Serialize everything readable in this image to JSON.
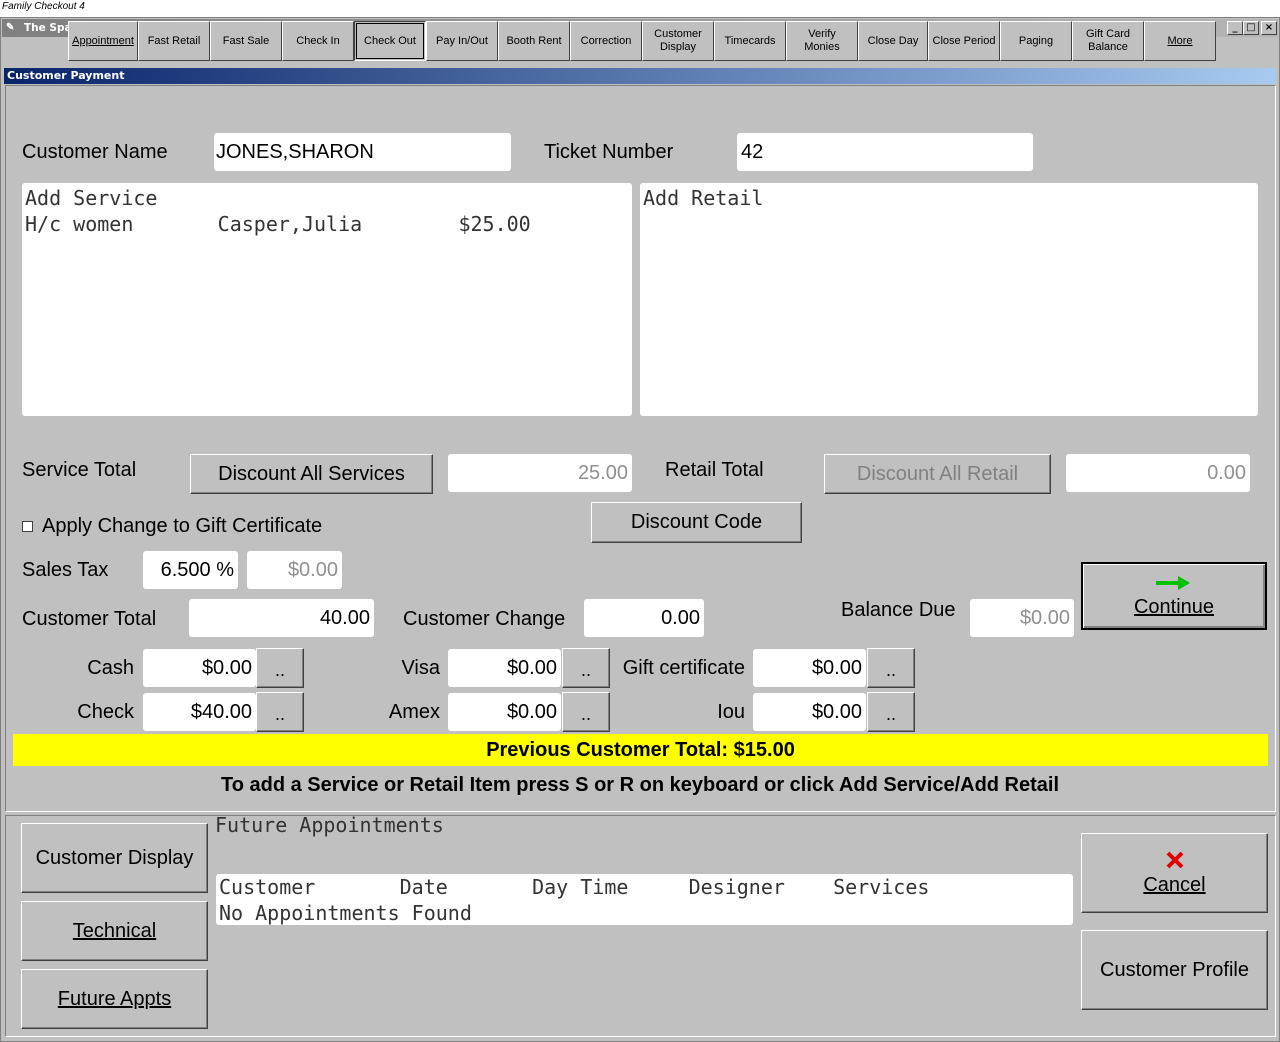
{
  "caption": "Family Checkout 4",
  "window": {
    "title": "The Spa/Salon Manager - SAMPLE SALON",
    "minimize": "_",
    "maximize": "□",
    "close": "×"
  },
  "toolbar": {
    "appointment": "Appointment",
    "fast_retail": "Fast Retail",
    "fast_sale": "Fast Sale",
    "check_in": "Check In",
    "check_out": "Check Out",
    "pay_in_out": "Pay In/Out",
    "booth_rent": "Booth Rent",
    "correction": "Correction",
    "customer_display_1": "Customer",
    "customer_display_2": "Display",
    "timecards": "Timecards",
    "verify_monies_1": "Verify",
    "verify_monies_2": "Monies",
    "close_day": "Close Day",
    "close_period": "Close Period",
    "paging": "Paging",
    "gift_card_1": "Gift Card",
    "gift_card_2": "Balance",
    "more": "More"
  },
  "panel_title": "Customer Payment",
  "customer": {
    "name_label": "Customer Name",
    "name_value": "JONES,SHARON",
    "ticket_label": "Ticket Number",
    "ticket_value": "42"
  },
  "services_list": {
    "header": "Add Service",
    "rows": [
      "H/c women       Casper,Julia        $25.00"
    ]
  },
  "retail_list": {
    "header": "Add Retail"
  },
  "totals": {
    "service_total_label": "Service Total",
    "discount_all_services": "Discount All Services",
    "service_total_value": "25.00",
    "retail_total_label": "Retail Total",
    "discount_all_retail": "Discount All Retail",
    "retail_total_value": "0.00",
    "discount_code": "Discount Code",
    "apply_gift_label": "Apply Change to Gift Certificate",
    "sales_tax_label": "Sales Tax",
    "sales_tax_rate": "6.500 %",
    "sales_tax_value": "$0.00",
    "customer_total_label": "Customer Total",
    "customer_total_value": "40.00",
    "customer_change_label": "Customer Change",
    "customer_change_value": "0.00",
    "balance_due_label": "Balance Due",
    "balance_due_value": "$0.00",
    "continue_label": "Continue"
  },
  "payments": {
    "cash_label": "Cash",
    "cash_value": "$0.00",
    "check_label": "Check",
    "check_value": "$40.00",
    "visa_label": "Visa",
    "visa_value": "$0.00",
    "amex_label": "Amex",
    "amex_value": "$0.00",
    "gift_label": "Gift certificate",
    "gift_value": "$0.00",
    "iou_label": "Iou",
    "iou_value": "$0.00",
    "dots": ".."
  },
  "previous_total": "Previous Customer Total: $15.00",
  "hint": "To add a Service or Retail Item press S or R on keyboard or click Add Service/Add Retail",
  "bottom": {
    "customer_display": "Customer Display",
    "technical": "Technical",
    "future_appts": "Future Appts",
    "future_title": "Future Appointments",
    "appt_header": "Customer       Date       Day Time     Designer    Services",
    "appt_empty": "No Appointments Found",
    "cancel": "Cancel",
    "customer_profile": "Customer Profile"
  },
  "colors": {
    "window_bg": "#c0c0c0",
    "prev_total_bg": "#ffff00",
    "continue_arrow": "#00c000",
    "cancel_x": "#e00000"
  }
}
